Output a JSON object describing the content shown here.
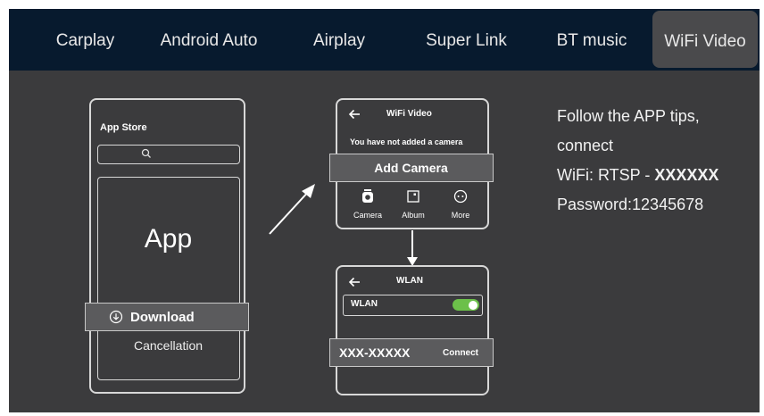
{
  "tabs": [
    {
      "label": "Carplay",
      "active": false
    },
    {
      "label": "Android Auto",
      "active": false
    },
    {
      "label": "Airplay",
      "active": false
    },
    {
      "label": "Super Link",
      "active": false
    },
    {
      "label": "BT music",
      "active": false
    },
    {
      "label": "WiFi Video",
      "active": true
    }
  ],
  "phone_app_store": {
    "title": "App Store",
    "app_label": "App",
    "download_label": "Download",
    "cancel_label": "Cancellation"
  },
  "phone_wifi_video": {
    "title": "WiFi Video",
    "message": "You have not added a camera",
    "add_camera_label": "Add Camera",
    "nav": [
      "Camera",
      "Album",
      "More"
    ]
  },
  "phone_wlan": {
    "title": "WLAN",
    "wlan_label": "WLAN",
    "wlan_enabled": true,
    "network_name": "XXX-XXXXX",
    "connect_label": "Connect"
  },
  "instructions": {
    "line1": "Follow the APP tips,",
    "line2": "connect",
    "wifi_prefix": "WiFi: RTSP -",
    "wifi_value": "XXXXXX",
    "password": "Password:12345678"
  },
  "colors": {
    "tab_bar": "#071a2e",
    "background": "#3b3b3d",
    "toggle_on": "#6cc04a"
  }
}
